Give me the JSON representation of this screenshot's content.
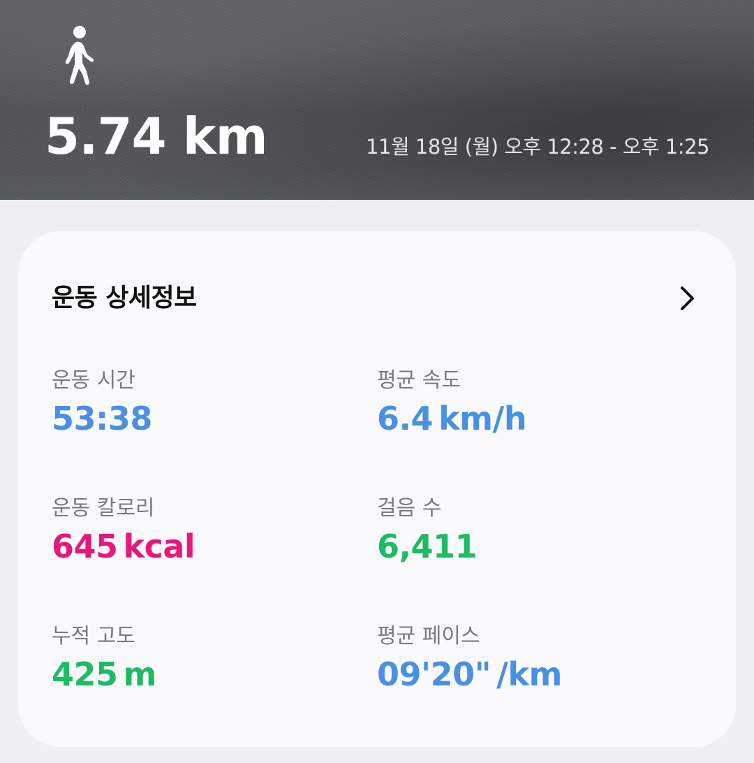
{
  "hero": {
    "activity_icon": "walking-person-icon",
    "distance": "5.74 km",
    "datetime": "11월 18일 (월) 오후 12:28 - 오후 1:25"
  },
  "card": {
    "title": "운동 상세정보",
    "chevron_icon": "chevron-right-icon",
    "stats": [
      {
        "label": "운동 시간",
        "value": "53:38",
        "unit": "",
        "color": "#4a90e2"
      },
      {
        "label": "평균 속도",
        "value": "6.4",
        "unit": "km/h",
        "color": "#4a90e2"
      },
      {
        "label": "운동 칼로리",
        "value": "645",
        "unit": "kcal",
        "color": "#e6187a"
      },
      {
        "label": "걸음 수",
        "value": "6,411",
        "unit": "",
        "color": "#1dbb63"
      },
      {
        "label": "누적 고도",
        "value": "425",
        "unit": "m",
        "color": "#1dbb63"
      },
      {
        "label": "평균 페이스",
        "value": "09'20\"",
        "unit": "/km",
        "color": "#4a90e2"
      }
    ]
  }
}
